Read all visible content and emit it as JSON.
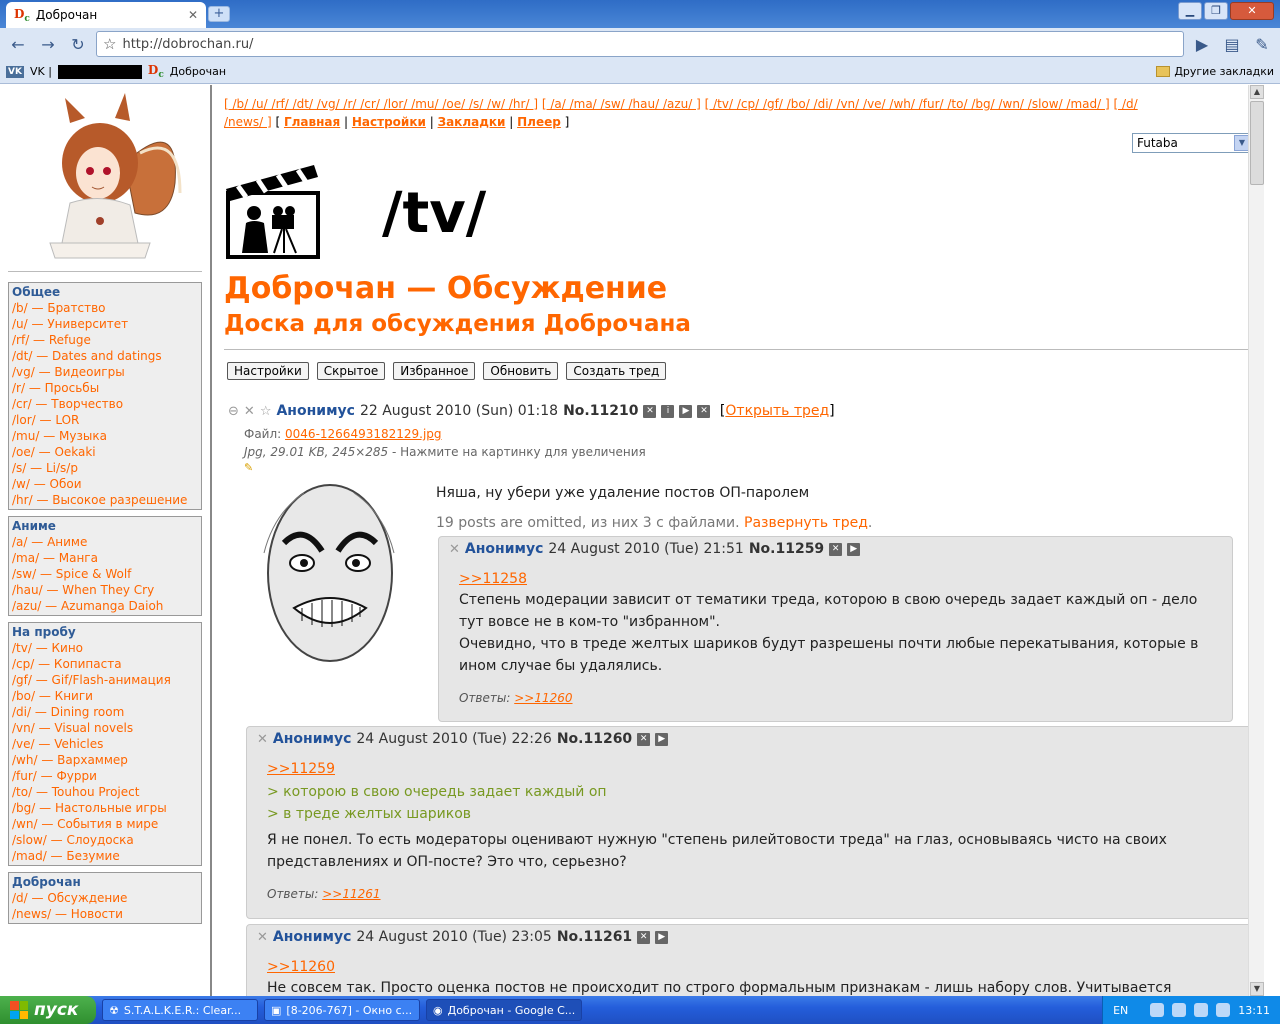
{
  "browser": {
    "tab_title": "Доброчан",
    "tab_logo": "Dc",
    "url": "http://dobrochan.ru/",
    "bookmarks": {
      "vk": "VK |",
      "dobrochan": "Доброчан",
      "other": "Другие закладки"
    }
  },
  "page": {
    "nav_boards_1": "[ /b/ /u/ /rf/ /dt/ /vg/ /r/ /cr/ /lor/ /mu/ /oe/ /s/ /w/ /hr/ ]",
    "nav_boards_2": "[ /a/ /ma/ /sw/ /hau/ /azu/ ]",
    "nav_boards_3": "[ /tv/ /cp/ /gf/ /bo/ /di/ /vn/ /ve/ /wh/ /fur/ /to/ /bg/ /wn/ /slow/ /mad/ ]",
    "nav_boards_4a": "[ /d/",
    "nav_boards_4b": "/news/ ]",
    "nav_links": {
      "home": "Главная",
      "settings": "Настройки",
      "bookmarks": "Закладки",
      "player": "Плеер"
    },
    "style_select": "Futaba",
    "board_code": "/tv/",
    "board_title": "Доброчан — Обсуждение",
    "board_subtitle": "Доска для обсуждения Доброчана",
    "buttons": {
      "settings": "Настройки",
      "hidden": "Скрытое",
      "favorites": "Избранное",
      "refresh": "Обновить",
      "create_thread": "Создать тред"
    }
  },
  "sidebar": {
    "groups": [
      {
        "title": "Общее",
        "items": [
          "/b/ — Братство",
          "/u/ — Университет",
          "/rf/ — Refuge",
          "/dt/ — Dates and datings",
          "/vg/ — Видеоигры",
          "/r/ — Просьбы",
          "/cr/ — Творчество",
          "/lor/ — LOR",
          "/mu/ — Музыка",
          "/oe/ — Oekaki",
          "/s/ — Li/s/p",
          "/w/ — Обои",
          "/hr/ — Высокое разрешение"
        ]
      },
      {
        "title": "Аниме",
        "items": [
          "/a/ — Аниме",
          "/ma/ — Манга",
          "/sw/ — Spice & Wolf",
          "/hau/ — When They Cry",
          "/azu/ — Azumanga Daioh"
        ]
      },
      {
        "title": "На пробу",
        "items": [
          "/tv/ — Кино",
          "/cp/ — Копипаста",
          "/gf/ — Gif/Flash-анимация",
          "/bo/ — Книги",
          "/di/ — Dining room",
          "/vn/ — Visual novels",
          "/ve/ — Vehicles",
          "/wh/ — Вархаммер",
          "/fur/ — Фурри",
          "/to/ — Touhou Project",
          "/bg/ — Настольные игры",
          "/wn/ — События в мире",
          "/slow/ — Слоудоска",
          "/mad/ — Безумие"
        ]
      },
      {
        "title": "Доброчан",
        "items": [
          "/d/ — Обсуждение",
          "/news/ — Новости"
        ]
      }
    ]
  },
  "thread": {
    "op": {
      "author": "Анонимус",
      "date": "22 August 2010 (Sun) 01:18",
      "no_label": "No.",
      "number": "11210",
      "open_thread": "Открыть тред",
      "file_label": "Файл:",
      "file_name": "0046-1266493182129.jpg",
      "file_meta": "Jpg, 29.01 KB, 245×285",
      "file_hint": "- Нажмите на картинку для увеличения",
      "text": "Няша, ну убери уже удаление постов ОП-паролем",
      "omitted": "19 posts are omitted, из них 3 с файлами.",
      "expand": "Развернуть тред"
    },
    "replies": [
      {
        "author": "Анонимус",
        "date": "24 August 2010 (Tue) 21:51",
        "number": "11259",
        "ref": ">>11258",
        "lines": [
          "Степень модерации зависит от тематики треда, которою в свою очередь задает каждый оп - дело",
          "тут вовсе не в ком-то \"избранном\".",
          "Очевидно, что в треде желтых шариков будут разрешены почти любые перекатывания, которые в",
          "ином случае бы удалялись."
        ],
        "answers_label": "Ответы:",
        "answers": ">>11260"
      },
      {
        "author": "Анонимус",
        "date": "24 August 2010 (Tue) 22:26",
        "number": "11260",
        "ref": ">>11259",
        "quotes": [
          "> которою в свою очередь задает каждый оп",
          "> в треде желтых шариков"
        ],
        "lines": [
          "Я не понел. То есть модераторы оценивают нужную \"степень рилейтовости треда\" на глаз, основываясь чисто на своих",
          "представлениях и ОП-посте? Это что, серьезно?"
        ],
        "answers_label": "Ответы:",
        "answers": ">>11261"
      },
      {
        "author": "Анонимус",
        "date": "24 August 2010 (Tue) 23:05",
        "number": "11261",
        "ref": ">>11260",
        "lines": [
          "Не совсем так. Просто оценка постов не происходит по строго формальным признакам - лишь набору слов. Учитывается"
        ]
      }
    ]
  },
  "taskbar": {
    "start": "пуск",
    "tasks": [
      "S.T.A.L.K.E.R.: Clear...",
      "[8-206-767] - Окно с...",
      "Доброчан - Google C..."
    ],
    "lang": "EN",
    "time": "13:11"
  }
}
